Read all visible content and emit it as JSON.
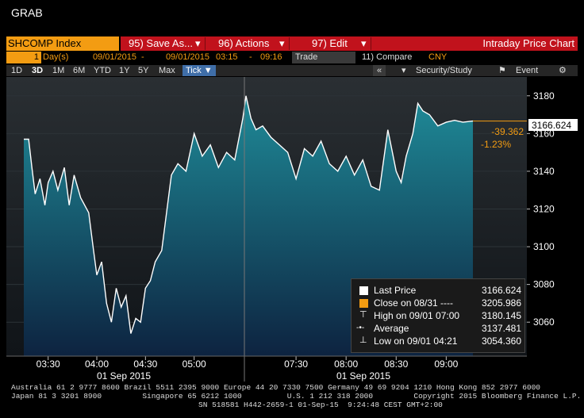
{
  "window": {
    "title": "GRAB"
  },
  "toolbar": {
    "ticker": "SHCOMP Index",
    "save_as": "95) Save As...",
    "actions": "96) Actions",
    "edit": "97) Edit",
    "title": "Intraday Price Chart"
  },
  "params": {
    "period_num": "1",
    "period_unit": "Day(s)",
    "start_date": "09/01/2015",
    "dash1": "-",
    "end_date": "09/01/2015",
    "start_time": "03:15",
    "dash2": "-",
    "end_time": "09:16",
    "field": "Trade",
    "compare": "11) Compare",
    "currency": "CNY"
  },
  "tabs": {
    "items": [
      "1D",
      "3D",
      "1M",
      "6M",
      "YTD",
      "1Y",
      "5Y",
      "Max",
      "Tick ▼"
    ],
    "active": "Tick ▼",
    "security_study": "Security/Study",
    "event": "Event",
    "collapse": "«"
  },
  "price_tag": {
    "last": "3166.624",
    "change": "-39.362",
    "change_pct": "-1.23%"
  },
  "legend": {
    "last_price_label": "Last Price",
    "last_price_value": "3166.624",
    "close_label": "Close on 08/31 ----",
    "close_value": "3205.986",
    "high_label": "High on 09/01 07:00",
    "high_value": "3180.145",
    "average_label": "Average",
    "average_value": "3137.481",
    "low_label": "Low on 09/01 04:21",
    "low_value": "3054.360"
  },
  "colors": {
    "orange": "#f39c12",
    "red_bar": "#c1121c",
    "teal_fill_top": "#1f8b98",
    "teal_fill_bottom": "#0d2340",
    "line": "#ffffff"
  },
  "footer": {
    "line1": "Australia 61 2 9777 8600 Brazil 5511 2395 9000 Europe 44 20 7330 7500 Germany 49 69 9204 1210 Hong Kong 852 2977 6000",
    "line2": "Japan 81 3 3201 8900         Singapore 65 6212 1000          U.S. 1 212 318 2000         Copyright 2015 Bloomberg Finance L.P.",
    "line3": "SN 518581 H442-2659-1 01-Sep-15  9:24:48 CEST GMT+2:00"
  },
  "chart_data": {
    "type": "area",
    "xlabel_sessions": [
      "01 Sep 2015",
      "01 Sep 2015"
    ],
    "x_ticks": [
      "03:30",
      "04:00",
      "04:30",
      "05:00",
      "07:30",
      "08:00",
      "08:30",
      "09:00"
    ],
    "y_ticks": [
      3060,
      3080,
      3100,
      3120,
      3140,
      3160,
      3180
    ],
    "ylim": [
      3042,
      3190
    ],
    "session_break": "05:30 / 07:00",
    "series": [
      {
        "name": "Last Price",
        "x": [
          "03:15",
          "03:18",
          "03:20",
          "03:22",
          "03:25",
          "03:28",
          "03:30",
          "03:33",
          "03:36",
          "03:40",
          "03:43",
          "03:46",
          "03:50",
          "03:55",
          "03:58",
          "04:00",
          "04:03",
          "04:06",
          "04:09",
          "04:12",
          "04:15",
          "04:18",
          "04:21",
          "04:24",
          "04:27",
          "04:30",
          "04:33",
          "04:36",
          "04:40",
          "04:43",
          "04:46",
          "04:50",
          "04:55",
          "05:00",
          "05:05",
          "05:10",
          "05:15",
          "05:20",
          "05:25",
          "05:30",
          "07:00",
          "07:03",
          "07:06",
          "07:10",
          "07:15",
          "07:20",
          "07:25",
          "07:30",
          "07:35",
          "07:40",
          "07:45",
          "07:50",
          "07:55",
          "08:00",
          "08:05",
          "08:10",
          "08:15",
          "08:20",
          "08:25",
          "08:30",
          "08:33",
          "08:36",
          "08:40",
          "08:43",
          "08:46",
          "08:50",
          "08:55",
          "09:00",
          "09:05",
          "09:10",
          "09:16"
        ],
        "values": [
          3157,
          3157,
          3142,
          3128,
          3136,
          3122,
          3134,
          3140,
          3130,
          3142,
          3122,
          3138,
          3126,
          3118,
          3098,
          3085,
          3092,
          3070,
          3060,
          3078,
          3068,
          3074,
          3054,
          3062,
          3060,
          3078,
          3082,
          3092,
          3098,
          3118,
          3138,
          3144,
          3140,
          3160,
          3148,
          3154,
          3142,
          3150,
          3146,
          3168,
          3180,
          3168,
          3162,
          3164,
          3158,
          3154,
          3150,
          3136,
          3152,
          3148,
          3156,
          3144,
          3140,
          3148,
          3138,
          3146,
          3132,
          3130,
          3162,
          3140,
          3134,
          3148,
          3160,
          3176,
          3172,
          3170,
          3164,
          3166,
          3167,
          3166,
          3166.624
        ]
      }
    ],
    "reference_line": {
      "name": "Close on 08/31",
      "value": 3205.986
    }
  }
}
